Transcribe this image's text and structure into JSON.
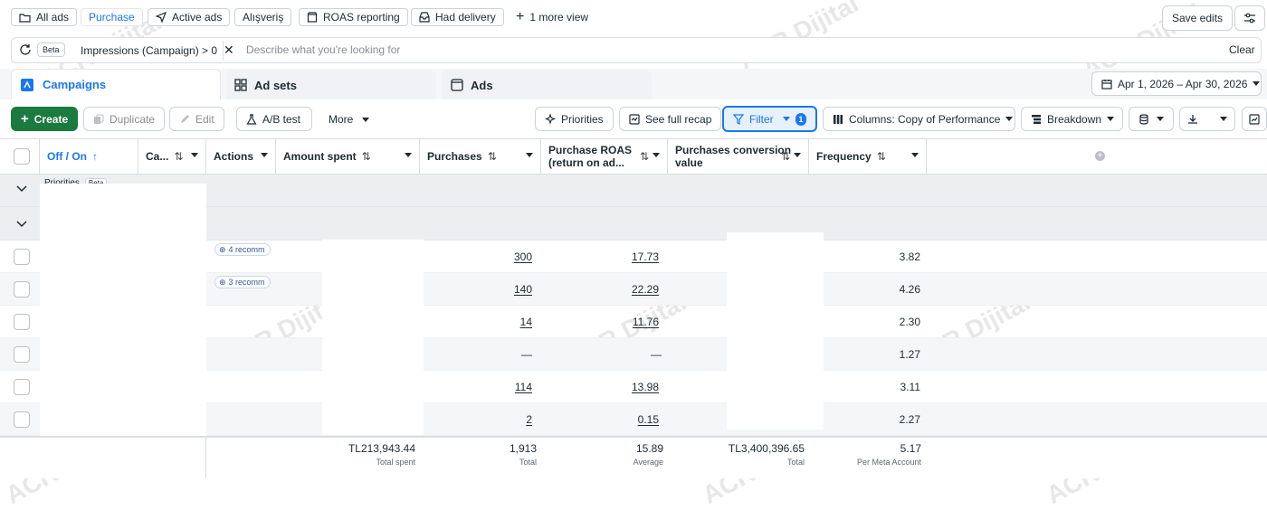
{
  "views": {
    "chips": [
      {
        "label": "All ads",
        "icon": "folder-icon"
      },
      {
        "label": "Purchase",
        "icon": ""
      },
      {
        "label": "Active ads",
        "icon": "send-icon"
      },
      {
        "label": "Alışveriş",
        "icon": ""
      },
      {
        "label": "ROAS reporting",
        "icon": "store-icon"
      },
      {
        "label": "Had delivery",
        "icon": "inbox-icon"
      }
    ],
    "more_view": "1 more view",
    "save_edits": "Save edits"
  },
  "search": {
    "beta": "Beta",
    "filter_pill": "Impressions (Campaign) > 0",
    "placeholder": "Describe what you're looking for",
    "clear": "Clear"
  },
  "tabs": {
    "campaigns": "Campaigns",
    "adsets": "Ad sets",
    "ads": "Ads",
    "date_range": "Apr 1, 2026 – Apr 30, 2026"
  },
  "toolbar": {
    "create": "Create",
    "duplicate": "Duplicate",
    "edit": "Edit",
    "ab_test": "A/B test",
    "more": "More",
    "priorities": "Priorities",
    "full_recap": "See full recap",
    "filter": "Filter",
    "filter_count": "1",
    "columns": "Columns: Copy of Performance",
    "breakdown": "Breakdown"
  },
  "table": {
    "headers": {
      "off_on": "Off / On",
      "campaign": "Ca...",
      "actions": "Actions",
      "amount_spent": "Amount spent",
      "purchases": "Purchases",
      "roas_line1": "Purchase ROAS",
      "roas_line2": "(return on ad...",
      "conv_line1": "Purchases conversion",
      "conv_line2": "value",
      "frequency": "Frequency"
    },
    "priorities_label": "Priorities",
    "priorities_beta": "Beta",
    "rows": [
      {
        "rec": "4 recomm",
        "purchases": "300",
        "roas": "17.73",
        "frequency": "3.82"
      },
      {
        "rec": "3 recomm",
        "purchases": "140",
        "roas": "22.29",
        "frequency": "4.26"
      },
      {
        "rec": "",
        "purchases": "14",
        "roas": "11.76",
        "frequency": "2.30"
      },
      {
        "rec": "",
        "purchases": "—",
        "roas": "—",
        "frequency": "1.27"
      },
      {
        "rec": "",
        "purchases": "114",
        "roas": "13.98",
        "frequency": "3.11"
      },
      {
        "rec": "",
        "purchases": "2",
        "roas": "0.15",
        "frequency": "2.27"
      }
    ],
    "footer": {
      "amount": "TL213,943.44",
      "amount_label": "Total spent",
      "purchases": "1,913",
      "purchases_label": "Total",
      "roas": "15.89",
      "roas_label": "Average",
      "conv": "TL3,400,396.65",
      "conv_label": "Total",
      "frequency": "5.17",
      "frequency_label": "Per Meta Account"
    }
  },
  "watermark": "ACR Dijital",
  "colors": {
    "accent": "#1877f2",
    "create_bg": "#1b7a3e",
    "filter_bg": "#e7f0fd"
  }
}
